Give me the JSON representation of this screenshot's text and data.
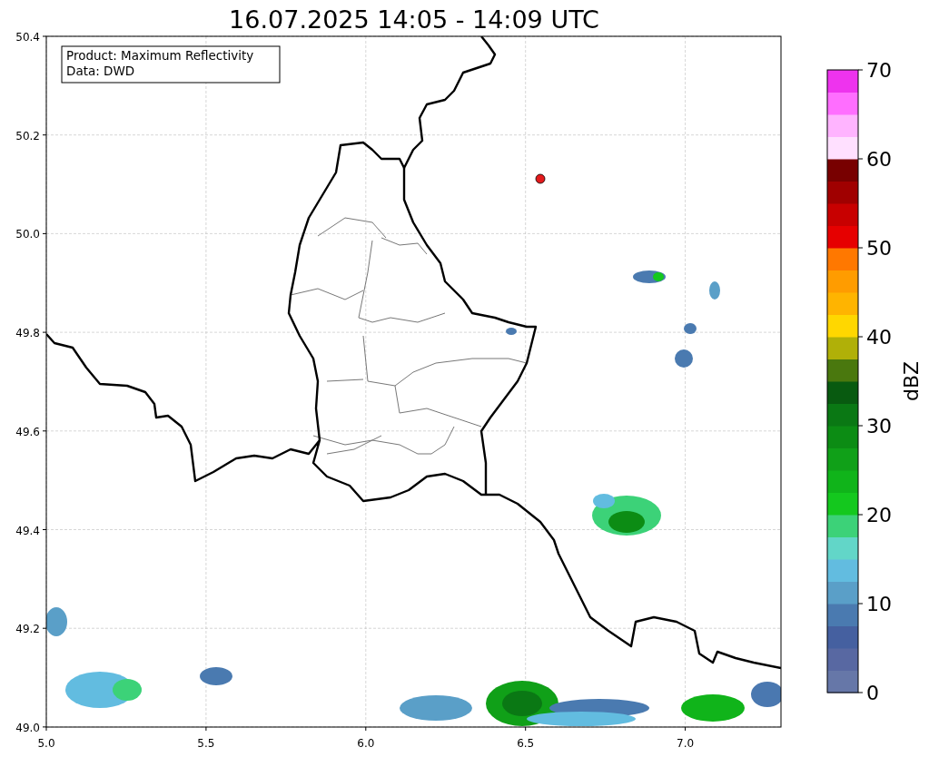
{
  "title": "16.07.2025 14:05 - 14:09 UTC",
  "info_box": [
    "Product: Maximum Reflectivity",
    "Data: DWD"
  ],
  "x_axis": {
    "ticks": [
      "5.0",
      "5.5",
      "6.0",
      "6.5",
      "7.0"
    ]
  },
  "y_axis": {
    "ticks": [
      "50.4",
      "50.2",
      "50.0",
      "49.8",
      "49.6",
      "49.4",
      "49.2",
      "49.0"
    ]
  },
  "colorbar": {
    "label": "dBZ",
    "ticks": [
      "70",
      "60",
      "50",
      "40",
      "30",
      "20",
      "10",
      "0"
    ],
    "segments": [
      {
        "color": "#6677a8"
      },
      {
        "color": "#5868a2"
      },
      {
        "color": "#4560a0"
      },
      {
        "color": "#4a7ab0"
      },
      {
        "color": "#5a9fc8"
      },
      {
        "color": "#62bce0"
      },
      {
        "color": "#62d6c8"
      },
      {
        "color": "#3cd278"
      },
      {
        "color": "#14c81e"
      },
      {
        "color": "#10b41a"
      },
      {
        "color": "#10a018"
      },
      {
        "color": "#0c8c14"
      },
      {
        "color": "#0a7814"
      },
      {
        "color": "#085a10"
      },
      {
        "color": "#4a780e"
      },
      {
        "color": "#b0b008"
      },
      {
        "color": "#ffd700"
      },
      {
        "color": "#ffb400"
      },
      {
        "color": "#ff9c00"
      },
      {
        "color": "#ff7800"
      },
      {
        "color": "#e60000"
      },
      {
        "color": "#c80000"
      },
      {
        "color": "#a00000"
      },
      {
        "color": "#780000"
      },
      {
        "color": "#ffe0ff"
      },
      {
        "color": "#ffb4ff"
      },
      {
        "color": "#ff6eff"
      },
      {
        "color": "#ee33ee"
      }
    ]
  }
}
